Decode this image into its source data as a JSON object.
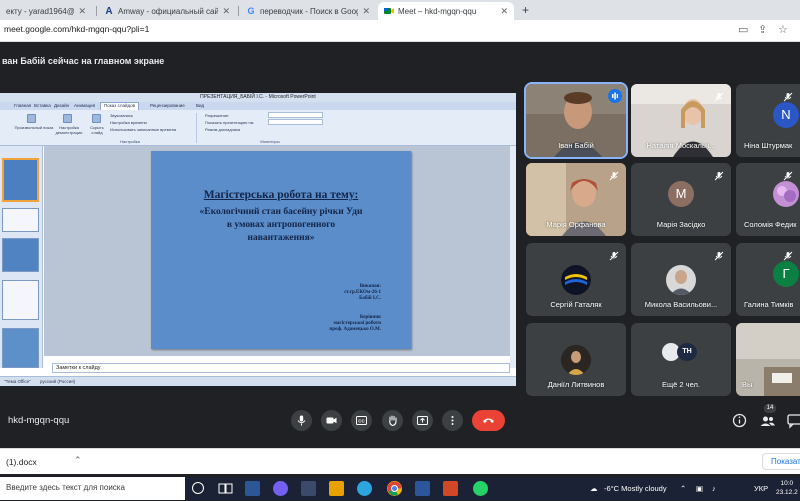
{
  "browser": {
    "tabs": [
      {
        "title": "екту - yarad1964@gmail.c",
        "favicon": "gmail-icon",
        "active": false
      },
      {
        "title": "Amway - официальный сайт и с",
        "favicon": "amway-icon",
        "active": false
      },
      {
        "title": "переводчик - Поиск в Google",
        "favicon": "google-icon",
        "active": false
      },
      {
        "title": "Meet – hkd-mgqn-qqu",
        "favicon": "meet-icon",
        "active": true
      }
    ],
    "new_tab": "+",
    "url": "meet.google.com/hkd-mgqn-qqu?pli=1"
  },
  "meet": {
    "presenting_banner": "ван Бабій сейчас на главном экране",
    "meeting_code": "hkd-mgqn-qqu",
    "participant_count": "14",
    "participants": [
      {
        "name": "Іван Бабій",
        "type": "video",
        "speaking": true
      },
      {
        "name": "Наталія Москальч...",
        "type": "video",
        "muted": true
      },
      {
        "name": "Ніна Штурмак",
        "type": "avatar",
        "initial": "N",
        "color": "#2a56c6",
        "muted": true
      },
      {
        "name": "Марія Орфанова",
        "type": "video",
        "muted": true
      },
      {
        "name": "Марія Засідко",
        "type": "avatar",
        "initial": "M",
        "color": "#8d6e63",
        "muted": true
      },
      {
        "name": "Соломія Федик",
        "type": "photo",
        "muted": true
      },
      {
        "name": "Сергій Гаталяк",
        "type": "logo",
        "muted": true
      },
      {
        "name": "Микола Васильови...",
        "type": "photo",
        "muted": true
      },
      {
        "name": "Галина Тимків",
        "type": "avatar",
        "initial": "Г",
        "color": "#0b8043",
        "muted": true
      },
      {
        "name": "Даніїл Литвинов",
        "type": "photo"
      },
      {
        "name": "Ещё 2 чел.",
        "type": "more"
      },
      {
        "name": "Вы",
        "type": "video"
      }
    ]
  },
  "powerpoint": {
    "window_title": "ПРЕЗЕНТАЦИЯ_БАБІЙ І.С. - Microsoft PowerPoint",
    "menu": [
      "Главная",
      "Вставка",
      "Дизайн",
      "Анимация",
      "Показ слайдов",
      "Рецензирование",
      "Вид"
    ],
    "active_menu": "Показ слайдов",
    "ribbon_items": [
      "Произвольный показ",
      "Настройка демонстрации",
      "Скрыть слайд",
      "Звукозапись",
      "Настройка времени",
      "Использовать записанные времена",
      "Разрешение:",
      "Показать презентацию на:",
      "Режим докладчика"
    ],
    "ribbon_groups": [
      "Настройка",
      "Мониторы"
    ],
    "slide": {
      "title": "Магістерська робота на тему:",
      "subtitle_lines": [
        "«Екологічний стан басейну річки Уди",
        "в умовах антропогенного",
        "навантаження»"
      ],
      "author_lines": [
        "Виконав:",
        "ст.гр.ЕКОм-26-1",
        "Бабій І.С."
      ],
      "supervisor_lines": [
        "Керівник",
        "магістерської роботи",
        "проф. Адамецько О.М."
      ]
    },
    "notes_placeholder": "Заметки к слайду",
    "status_bar": [
      "\"Тема Office\"",
      "русский (Россия)"
    ]
  },
  "downloads": {
    "file": "(1).docx",
    "show_all": "Показать"
  },
  "taskbar": {
    "search_placeholder": "Введите здесь текст для поиска",
    "weather": "-6°C  Mostly cloudy",
    "language": "УКР",
    "time": "10:0",
    "date": "23.12.2"
  },
  "colors": {
    "meet_bg": "#202124",
    "leave_red": "#ea4335",
    "slide_blue": "#5a8dc9",
    "speaking_blue": "#1a73e8"
  }
}
